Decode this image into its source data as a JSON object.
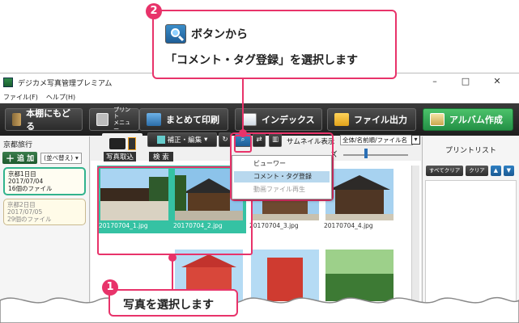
{
  "callout_top": {
    "number": "2",
    "line1_suffix": "ボタンから",
    "line2": "「コメント・タグ登録」を選択します"
  },
  "callout_bottom": {
    "number": "1",
    "text": "写真を選択します"
  },
  "window": {
    "title": "デジカメ写真管理プレミアム",
    "controls": [
      "–",
      "□",
      "✕"
    ],
    "menu": [
      "ファイル(F)",
      "ヘルプ(H)"
    ]
  },
  "toolbar": {
    "back": "本棚にもどる",
    "print_menu_line1": "プリント",
    "print_menu_line2": "メニュー",
    "batch_print": "まとめて印刷",
    "index": "インデックス",
    "file_output": "ファイル出力",
    "album_create": "アルバム作成"
  },
  "left_panel": {
    "header": "京都旅行",
    "add_label": "追 加",
    "sort_label": "(並べ替え)",
    "albums": [
      {
        "name": "京都1日目",
        "date": "2017/07/04",
        "count": "16個のファイル",
        "selected": true
      },
      {
        "name": "京都2日目",
        "date": "2017/07/05",
        "count": "29個のファイル",
        "selected": false
      }
    ]
  },
  "center": {
    "photo_import": "写真取込",
    "search": "検 索",
    "correct_edit": "補正・編集",
    "thumb_display_label": "サムネイル表示",
    "thumb_display_value": "全体/名前順/ファイル名",
    "size_label": "ズ",
    "photos": [
      {
        "name": "20170704_1.jpg",
        "selected": true
      },
      {
        "name": "20170704_2.jpg",
        "selected": true
      },
      {
        "name": "20170704_3.jpg",
        "selected": false
      },
      {
        "name": "20170704_4.jpg",
        "selected": false
      }
    ]
  },
  "dropdown": {
    "items": [
      {
        "label": "ビューワー",
        "state": "normal"
      },
      {
        "label": "コメント・タグ登録",
        "state": "highlighted"
      },
      {
        "label": "動画ファイル再生",
        "state": "disabled"
      }
    ]
  },
  "right_panel": {
    "header": "プリントリスト",
    "clear_all": "すべてクリア",
    "clear": "クリア",
    "up": "▲",
    "down": "▼"
  },
  "colors": {
    "accent": "#e8336a",
    "selection": "#35c2a3",
    "album_green": "#31b38d"
  }
}
